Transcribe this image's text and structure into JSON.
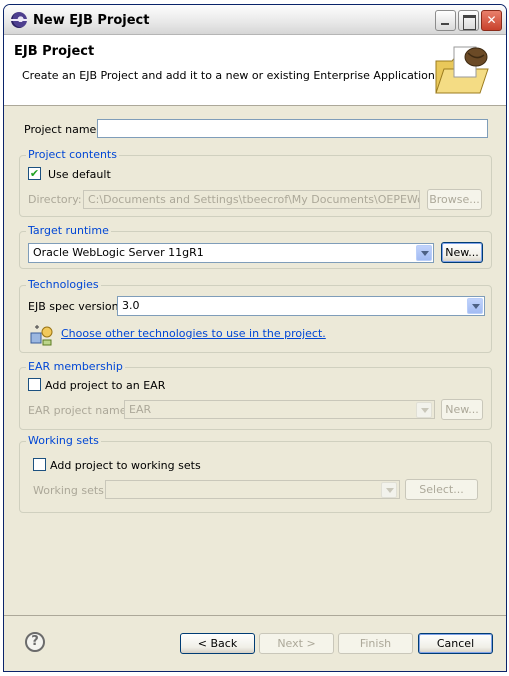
{
  "window": {
    "title": "New EJB Project"
  },
  "banner": {
    "title": "EJB Project",
    "description": "Create an EJB Project and add it to a new or existing Enterprise Application."
  },
  "project_name": {
    "label": "Project name:",
    "value": ""
  },
  "project_contents": {
    "group_title": "Project contents",
    "use_default_label": "Use default",
    "use_default_checked": true,
    "directory_label": "Directory:",
    "directory_value": "C:\\Documents and Settings\\tbeecrof\\My Documents\\OEPEWorkspace",
    "browse_label": "Browse..."
  },
  "target_runtime": {
    "group_title": "Target runtime",
    "selected": "Oracle WebLogic Server 11gR1",
    "new_label": "New..."
  },
  "technologies": {
    "group_title": "Technologies",
    "ejb_spec_label": "EJB spec version:",
    "ejb_spec_value": "3.0",
    "other_tech_link": "Choose other technologies to use in the project."
  },
  "ear_membership": {
    "group_title": "EAR membership",
    "add_to_ear_label": "Add project to an EAR",
    "add_to_ear_checked": false,
    "ear_name_label": "EAR project name:",
    "ear_name_value": "EAR",
    "new_label": "New..."
  },
  "working_sets": {
    "group_title": "Working sets",
    "add_label": "Add project to working sets",
    "add_checked": false,
    "sets_label": "Working sets:",
    "sets_value": "",
    "select_label": "Select..."
  },
  "footer": {
    "back_label": "< Back",
    "next_label": "Next >",
    "finish_label": "Finish",
    "cancel_label": "Cancel"
  },
  "icons": {
    "window": "eclipse-icon",
    "banner": "folder-bean-icon",
    "help": "help-icon",
    "technologies": "technologies-icon"
  }
}
